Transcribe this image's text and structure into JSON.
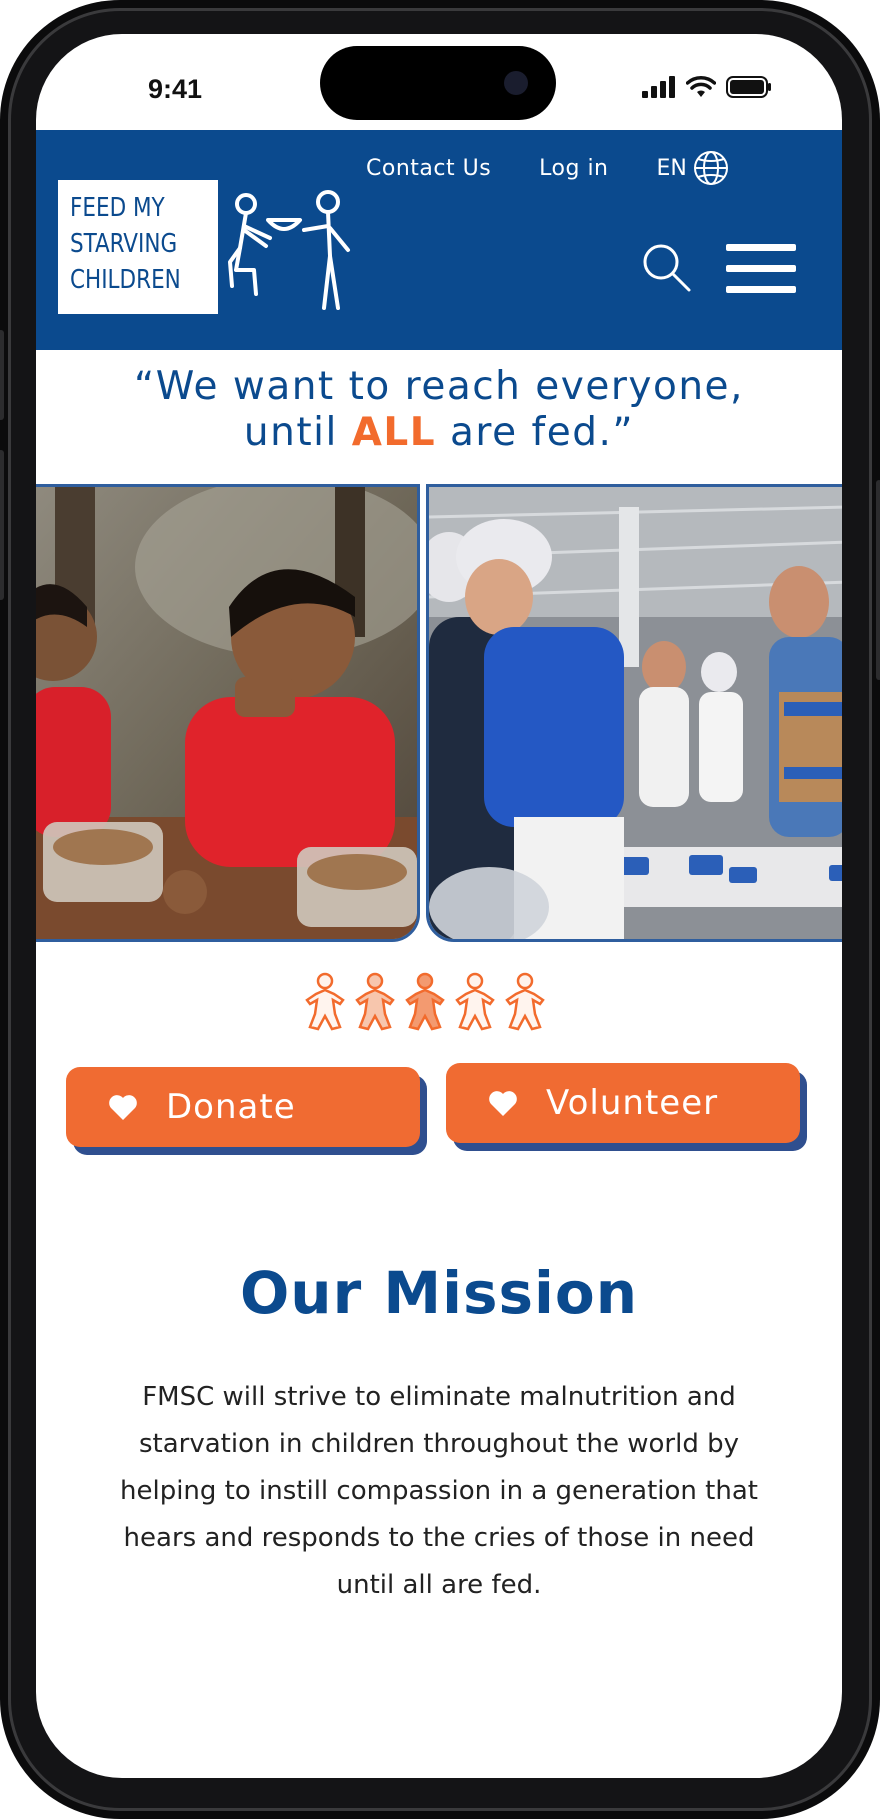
{
  "status_bar": {
    "time": "9:41"
  },
  "header": {
    "logo_lines": [
      "FEED MY",
      "STARVING",
      "CHILDREN"
    ],
    "links": {
      "contact": "Contact Us",
      "login": "Log in",
      "language": "EN"
    }
  },
  "quote": {
    "before": "“We want to reach everyone,",
    "line2_start": "until ",
    "accent": "ALL",
    "line2_end": " are fed.”"
  },
  "actions": {
    "donate": "Donate",
    "volunteer": "Volunteer"
  },
  "mission": {
    "title": "Our Mission",
    "body": "FMSC will strive to eliminate malnutrition and starvation in children throughout the world by helping to instill compassion in a generation that hears and responds to the cries of those in need until all are fed."
  },
  "colors": {
    "brand_blue": "#0b4a8e",
    "accent_orange": "#f26b2d",
    "button_orange": "#f06b32"
  },
  "icons": [
    "signal-icon",
    "wifi-icon",
    "battery-icon",
    "globe-icon",
    "search-icon",
    "menu-icon",
    "heart-icon",
    "child-figure-icon"
  ]
}
